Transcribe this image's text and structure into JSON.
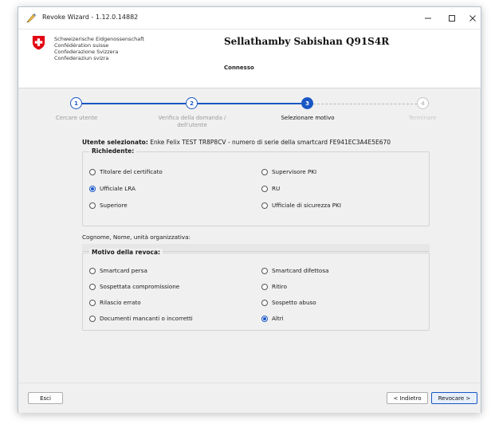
{
  "window": {
    "title": "Revoke Wizard - 1.12.0.14882",
    "controls": {
      "minimize": "–",
      "maximize": "☐",
      "close": "✕"
    }
  },
  "header": {
    "org_names": [
      "Schweizerische Eidgenossenschaft",
      "Confédération suisse",
      "Confederazione Svizzera",
      "Confederaziun svizra"
    ],
    "user_name": "Sellathamby Sabishan Q91S4R",
    "connection_status": "Connesso"
  },
  "wizard": {
    "steps": [
      {
        "number": "1",
        "label": "Cercare utente",
        "state": "done"
      },
      {
        "number": "2",
        "label": "Verifica della domanda / dell'utente",
        "state": "done"
      },
      {
        "number": "3",
        "label": "Selezionare motivo",
        "state": "active"
      },
      {
        "number": "4",
        "label": "Terminare",
        "state": "future"
      }
    ]
  },
  "selected_user": {
    "label": "Utente selezionato:",
    "value": " Enke Felix TEST TR8P8CV - numero di serie della smartcard FE941EC3A4E5E670"
  },
  "requester": {
    "title": "Richiedente:",
    "options": [
      {
        "label": "Titolare del certificato",
        "checked": false
      },
      {
        "label": "Supervisore PKI",
        "checked": false
      },
      {
        "label": "Ufficiale LRA",
        "checked": true
      },
      {
        "label": "RU",
        "checked": false
      },
      {
        "label": "Superiore",
        "checked": false
      },
      {
        "label": "Ufficiale di sicurezza PKI",
        "checked": false
      }
    ]
  },
  "org_field": {
    "label": "Cognome, Nome, unità organizzativa:",
    "value": ""
  },
  "reason": {
    "title": "Motivo della revoca:",
    "options": [
      {
        "label": "Smartcard persa",
        "checked": false
      },
      {
        "label": "Smartcard difettosa",
        "checked": false
      },
      {
        "label": "Sospettata compromissione",
        "checked": false
      },
      {
        "label": "Ritiro",
        "checked": false
      },
      {
        "label": "Rilascio errato",
        "checked": false
      },
      {
        "label": "Sospetto abuso",
        "checked": false
      },
      {
        "label": "Documenti mancanti o incorretti",
        "checked": false
      },
      {
        "label": "Altri",
        "checked": true
      }
    ]
  },
  "footer": {
    "exit_label": "Esci",
    "back_label": "< Indietro",
    "revoke_label": "Revocare >"
  },
  "colors": {
    "accent": "#1a56c4",
    "swiss_red": "#e30613"
  }
}
